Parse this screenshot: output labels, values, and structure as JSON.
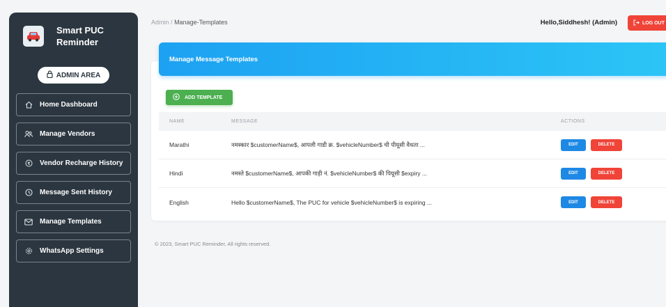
{
  "brand": {
    "line1": "Smart PUC",
    "line2": "Reminder"
  },
  "admin_area": "ADMIN AREA",
  "sidebar": {
    "items": [
      {
        "label": "Home Dashboard",
        "icon": "home-icon"
      },
      {
        "label": "Manage Vendors",
        "icon": "users-icon"
      },
      {
        "label": "Vendor Recharge History",
        "icon": "history-coin-icon"
      },
      {
        "label": "Message Sent History",
        "icon": "clock-icon"
      },
      {
        "label": "Manage Templates",
        "icon": "mail-icon"
      },
      {
        "label": "WhatsApp Settings",
        "icon": "gear-icon"
      }
    ]
  },
  "header": {
    "breadcrumb_root": "Admin",
    "breadcrumb_sep": "/",
    "breadcrumb_current": "Manage-Templates",
    "greeting": "Hello,Siddhesh! (Admin)",
    "logout_label": "LOG OUT"
  },
  "card": {
    "title": "Manage Message Templates",
    "add_label": "ADD TEMPLATE"
  },
  "table": {
    "columns": [
      "NAME",
      "MESSAGE",
      "ACTIONS"
    ],
    "rows": [
      {
        "name": "Marathi",
        "message": "नमस्कार $customerName$, आपली गाडी क्र. $vehicleNumber$ ची पीयूसी वैधता ..."
      },
      {
        "name": "Hindi",
        "message": "नमस्ते $customerName$, आपकी गाड़ी नं. $vehicleNumber$ की पियूसी $expiry ..."
      },
      {
        "name": "English",
        "message": "Hello $customerName$, The PUC for vehicle $vehicleNumber$ is expiring ..."
      }
    ],
    "edit_label": "EDIT",
    "delete_label": "DELETE"
  },
  "footer": "© 2023, Smart PUC Reminder, All rights reserved.",
  "colors": {
    "sidebar": "#2b3640",
    "accent": "#1da1f2",
    "success": "#4caf50",
    "danger": "#f04438",
    "edit": "#1e88e5"
  }
}
